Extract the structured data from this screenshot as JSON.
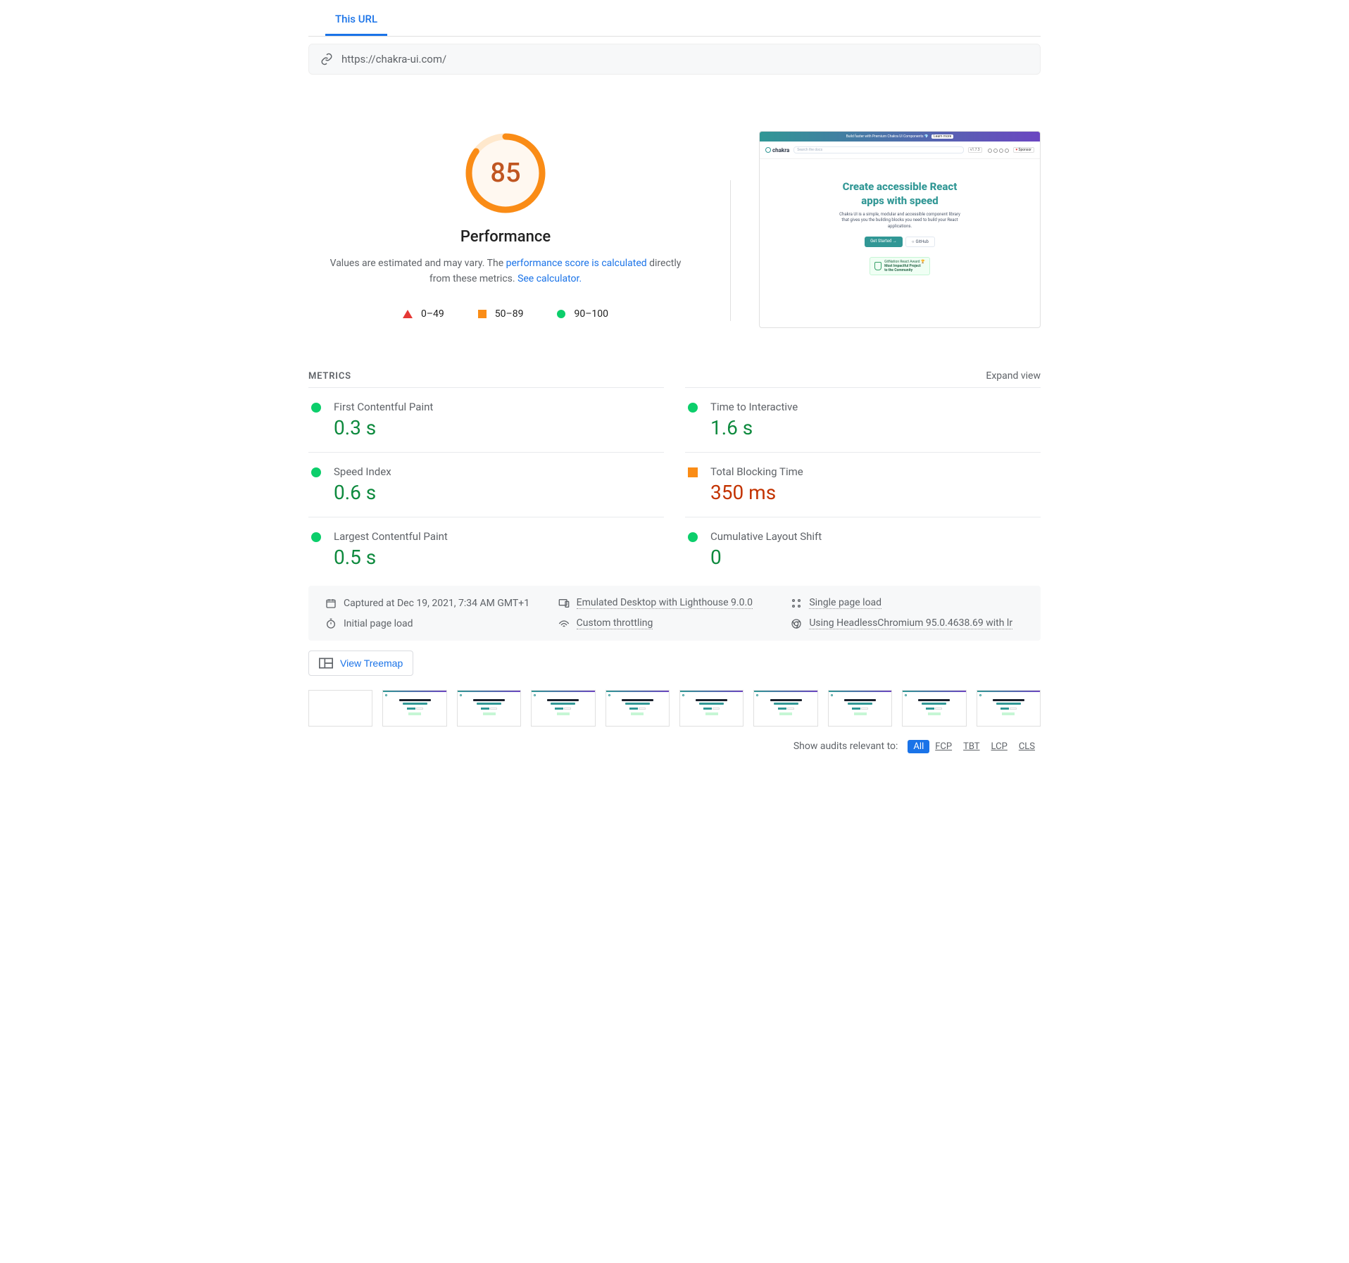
{
  "tab": {
    "label": "This URL"
  },
  "url": "https://chakra-ui.com/",
  "score": {
    "value": "85",
    "title": "Performance",
    "desc_prefix": "Values are estimated and may vary. The ",
    "link1": "performance score is calculated",
    "desc_mid": " directly from these metrics. ",
    "link2": "See calculator.",
    "gauge_dashoffset": 49
  },
  "legend": {
    "bad": "0–49",
    "mid": "50–89",
    "good": "90–100"
  },
  "preview": {
    "banner_text": "Build faster with Premium Chakra UI Components 💎",
    "banner_cta": "Learn more",
    "logo": "chakra",
    "search_placeholder": "Search the docs",
    "version_badge": "v1.7.3",
    "sponsor": "Sponsor",
    "hero_line1": "Create accessible React",
    "hero_line2_a": "apps ",
    "hero_line2_b": "with speed",
    "sub": "Chakra UI is a simple, modular and accessible component library that gives you the building blocks you need to build your React applications.",
    "btn1": "Get Started →",
    "btn2": "GitHub",
    "award_line1": "GitNation React Award 🏆",
    "award_line2": "Most Impactful Project",
    "award_line3": "to the Community"
  },
  "metrics_header": {
    "title": "METRICS",
    "expand": "Expand view"
  },
  "metrics": [
    {
      "status": "good",
      "label": "First Contentful Paint",
      "value": "0.3 s"
    },
    {
      "status": "good",
      "label": "Time to Interactive",
      "value": "1.6 s"
    },
    {
      "status": "good",
      "label": "Speed Index",
      "value": "0.6 s"
    },
    {
      "status": "mid",
      "label": "Total Blocking Time",
      "value": "350 ms"
    },
    {
      "status": "good",
      "label": "Largest Contentful Paint",
      "value": "0.5 s"
    },
    {
      "status": "good",
      "label": "Cumulative Layout Shift",
      "value": "0"
    }
  ],
  "env": {
    "captured": "Captured at Dec 19, 2021, 7:34 AM GMT+1",
    "emulated": "Emulated Desktop with Lighthouse 9.0.0",
    "single": "Single page load",
    "initial": "Initial page load",
    "throttling": "Custom throttling",
    "browser": "Using HeadlessChromium 95.0.4638.69 with lr"
  },
  "treemap": "View Treemap",
  "filter": {
    "label": "Show audits relevant to:",
    "options": [
      "All",
      "FCP",
      "TBT",
      "LCP",
      "CLS"
    ]
  }
}
